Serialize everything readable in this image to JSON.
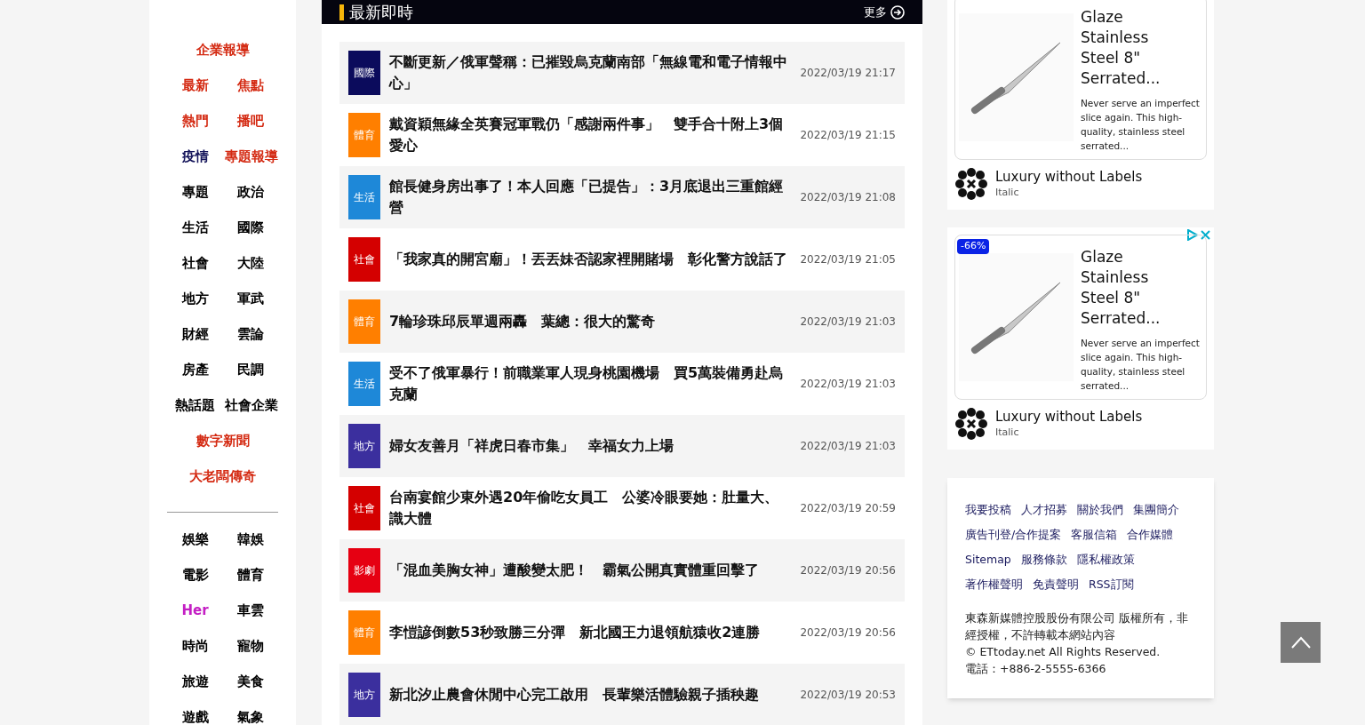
{
  "sidebar": {
    "groups": [
      {
        "rows": [
          [
            {
              "label": "企業報導",
              "color": "#d42a12"
            }
          ],
          [
            {
              "label": "最新",
              "color": "#d42a12"
            },
            {
              "label": "焦點",
              "color": "#d42a12"
            }
          ],
          [
            {
              "label": "熱門",
              "color": "#d42a12"
            },
            {
              "label": "播吧",
              "color": "#d42a12"
            }
          ],
          [
            {
              "label": "疫情",
              "color": "#14145a"
            },
            {
              "label": "專題報導",
              "color": "#d42a12"
            }
          ],
          [
            {
              "label": "專題",
              "color": "#000000"
            },
            {
              "label": "政治",
              "color": "#000000"
            }
          ],
          [
            {
              "label": "生活",
              "color": "#000000"
            },
            {
              "label": "國際",
              "color": "#000000"
            }
          ],
          [
            {
              "label": "社會",
              "color": "#000000"
            },
            {
              "label": "大陸",
              "color": "#000000"
            }
          ],
          [
            {
              "label": "地方",
              "color": "#000000"
            },
            {
              "label": "軍武",
              "color": "#000000"
            }
          ],
          [
            {
              "label": "財經",
              "color": "#000000"
            },
            {
              "label": "雲論",
              "color": "#000000"
            }
          ],
          [
            {
              "label": "房產",
              "color": "#000000"
            },
            {
              "label": "民調",
              "color": "#000000"
            }
          ],
          [
            {
              "label": "熱話題",
              "color": "#000000"
            },
            {
              "label": "社會企業",
              "color": "#000000"
            }
          ],
          [
            {
              "label": "數字新聞",
              "color": "#d42a12"
            }
          ],
          [
            {
              "label": "大老闆傳奇",
              "color": "#d42a12"
            }
          ]
        ]
      },
      {
        "rows": [
          [
            {
              "label": "娛樂",
              "color": "#000000"
            },
            {
              "label": "韓娛",
              "color": "#000000"
            }
          ],
          [
            {
              "label": "電影",
              "color": "#000000"
            },
            {
              "label": "體育",
              "color": "#000000"
            }
          ],
          [
            {
              "label": "Her",
              "color": "#c41fc4"
            },
            {
              "label": "車雲",
              "color": "#000000"
            }
          ],
          [
            {
              "label": "時尚",
              "color": "#000000"
            },
            {
              "label": "寵物",
              "color": "#000000"
            }
          ],
          [
            {
              "label": "旅遊",
              "color": "#000000"
            },
            {
              "label": "美食",
              "color": "#000000"
            }
          ],
          [
            {
              "label": "遊戲",
              "color": "#000000"
            },
            {
              "label": "氣象",
              "color": "#000000"
            }
          ]
        ]
      }
    ]
  },
  "news": {
    "title": "最新即時",
    "more": "更多",
    "items": [
      {
        "category": "國際",
        "color": "#0b0b5c",
        "title": "不斷更新／俄軍聲稱：已摧毀烏克蘭南部「無線電和電子情報中心」",
        "time": "2022/03/19 21:17"
      },
      {
        "category": "體育",
        "color": "#ff7f00",
        "title": "戴資穎無緣全英賽冠軍戰仍「感謝兩件事」　雙手合十附上3個愛心",
        "time": "2022/03/19 21:15"
      },
      {
        "category": "生活",
        "color": "#1e88d8",
        "title": "館長健身房出事了！本人回應「已提告」：3月底退出三重館經營",
        "time": "2022/03/19 21:08"
      },
      {
        "category": "社會",
        "color": "#d40000",
        "title": "「我家真的開宮廟」！丟丟妹否認家裡開賭場　彰化警方說話了",
        "time": "2022/03/19 21:05"
      },
      {
        "category": "體育",
        "color": "#ff7f00",
        "title": "7輪珍珠邱辰單週兩轟　葉總：很大的驚奇",
        "time": "2022/03/19 21:03"
      },
      {
        "category": "生活",
        "color": "#1e88d8",
        "title": "受不了俄軍暴行！前職業軍人現身桃園機場　買5萬裝備勇赴烏克蘭",
        "time": "2022/03/19 21:03"
      },
      {
        "category": "地方",
        "color": "#3b2f9e",
        "title": "婦女友善月「祥虎日春市集」　幸福女力上場",
        "time": "2022/03/19 21:03"
      },
      {
        "category": "社會",
        "color": "#d40000",
        "title": "台南宴館少東外遇20年偷吃女員工　公婆冷眼要她：肚量大、識大體",
        "time": "2022/03/19 20:59"
      },
      {
        "category": "影劇",
        "color": "#e60012",
        "title": "「混血美胸女神」遭酸變太肥！　霸氣公開真實體重回擊了",
        "time": "2022/03/19 20:56"
      },
      {
        "category": "體育",
        "color": "#ff7f00",
        "title": "李愷諺倒數53秒致勝三分彈　新北國王力退領航猿收2連勝",
        "time": "2022/03/19 20:56"
      },
      {
        "category": "地方",
        "color": "#3b2f9e",
        "title": "新北汐止農會休閒中心完工啟用　長輩樂活體驗親子插秧趣",
        "time": "2022/03/19 20:53"
      }
    ]
  },
  "ads": [
    {
      "title": "Glaze Stainless Steel 8\" Serrated...",
      "text": "Never serve an imperfect slice again. This high-quality, stainless steel serrated...",
      "brand": "Luxury without Labels",
      "sub": "Italic"
    },
    {
      "badge": "-66%",
      "title": "Glaze Stainless Steel 8\" Serrated...",
      "text": "Never serve an imperfect slice again. This high-quality, stainless steel serrated...",
      "brand": "Luxury without Labels",
      "sub": "Italic"
    }
  ],
  "footer": {
    "link_rows": [
      [
        "我要投稿",
        "人才招募",
        "關於我們",
        "集團簡介"
      ],
      [
        "廣告刊登/合作提案",
        "客服信箱",
        "合作媒體"
      ],
      [
        "Sitemap",
        "服務條款",
        "隱私權政策"
      ],
      [
        "著作權聲明",
        "免責聲明",
        "RSS訂閱"
      ]
    ],
    "copyright": [
      "東森新媒體控股股份有限公司 版權所有，非經授權，不許轉載本網站內容",
      "© ETtoday.net All Rights Reserved.",
      "電話：+886-2-5555-6366"
    ]
  }
}
